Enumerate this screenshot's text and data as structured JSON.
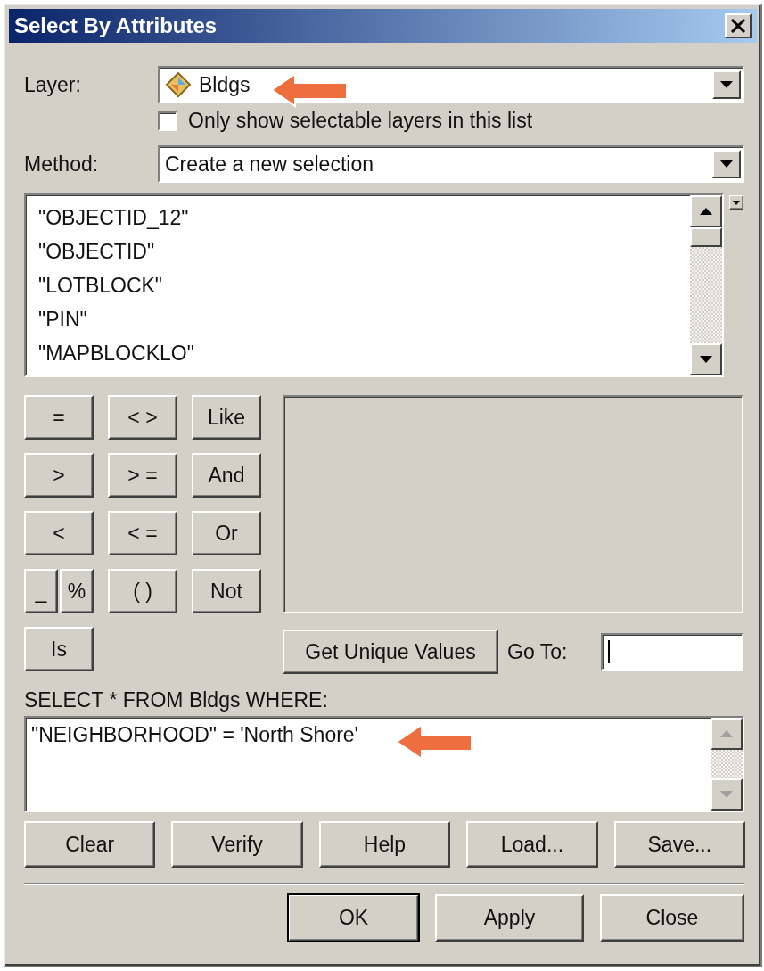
{
  "window": {
    "title": "Select By Attributes"
  },
  "layer": {
    "label": "Layer:",
    "value": "Bldgs"
  },
  "only_selectable": {
    "label": "Only show selectable layers in this list",
    "checked": false
  },
  "method": {
    "label": "Method:",
    "value": "Create a new selection"
  },
  "fields": [
    "\"OBJECTID_12\"",
    "\"OBJECTID\"",
    "\"LOTBLOCK\"",
    "\"PIN\"",
    "\"MAPBLOCKLO\""
  ],
  "operators": [
    [
      {
        "label": "=",
        "kind": "full"
      },
      {
        "label": "< >",
        "kind": "full"
      },
      {
        "label": "Like",
        "kind": "full"
      }
    ],
    [
      {
        "label": ">",
        "kind": "full"
      },
      {
        "label": "> =",
        "kind": "full"
      },
      {
        "label": "And",
        "kind": "full"
      }
    ],
    [
      {
        "label": "<",
        "kind": "full"
      },
      {
        "label": "< =",
        "kind": "full"
      },
      {
        "label": "Or",
        "kind": "full"
      }
    ],
    [
      {
        "label": "_",
        "kind": "half"
      },
      {
        "label": "%",
        "kind": "half"
      },
      {
        "label": "( )",
        "kind": "full"
      },
      {
        "label": "Not",
        "kind": "full"
      }
    ],
    [
      {
        "label": "Is",
        "kind": "full"
      }
    ]
  ],
  "unique_values": {
    "button": "Get Unique Values"
  },
  "go_to": {
    "label": "Go To:"
  },
  "expression": {
    "label": "SELECT * FROM Bldgs WHERE:",
    "value": "\"NEIGHBORHOOD\" = 'North Shore'"
  },
  "expression_buttons": [
    "Clear",
    "Verify",
    "Help",
    "Load...",
    "Save..."
  ],
  "dialog_buttons": [
    {
      "label": "OK",
      "default": true
    },
    {
      "label": "Apply",
      "default": false
    },
    {
      "label": "Close",
      "default": false
    }
  ]
}
